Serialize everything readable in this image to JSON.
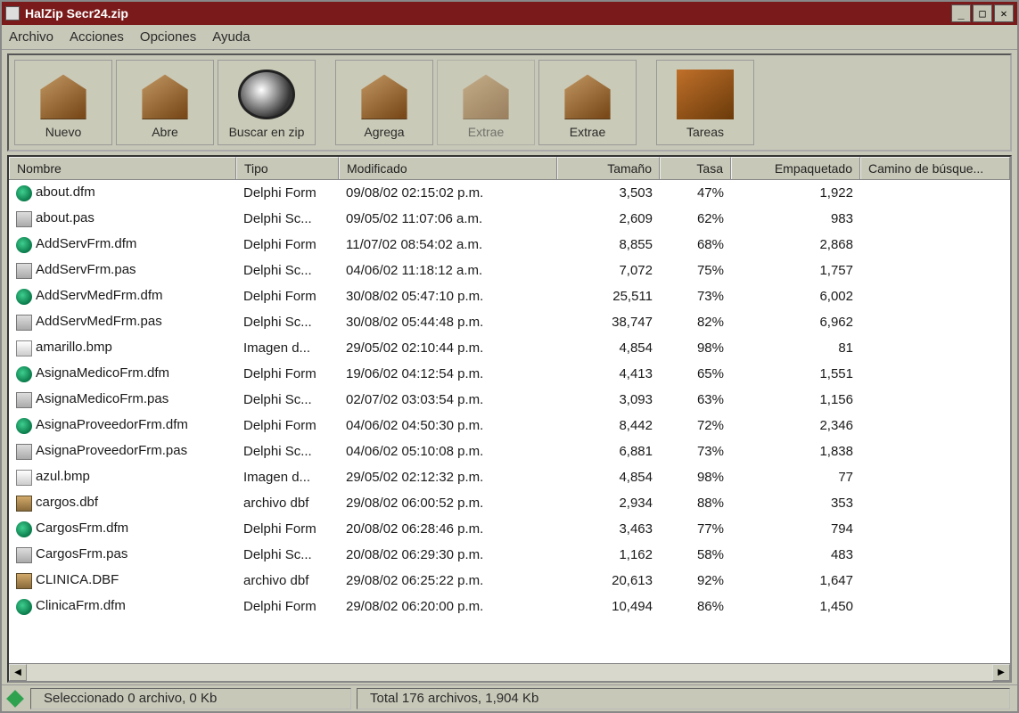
{
  "window": {
    "title": "HalZip Secr24.zip"
  },
  "menubar": [
    "Archivo",
    "Acciones",
    "Opciones",
    "Ayuda"
  ],
  "toolbar": [
    {
      "label": "Nuevo",
      "icon": "box-new",
      "disabled": false
    },
    {
      "label": "Abre",
      "icon": "box-open",
      "disabled": false
    },
    {
      "label": "Buscar en zip",
      "icon": "magnify",
      "disabled": false
    },
    {
      "label": "Agrega",
      "icon": "box-add",
      "disabled": false,
      "sep_before": true
    },
    {
      "label": "Extrae",
      "icon": "box-extract",
      "disabled": true
    },
    {
      "label": "Extrae",
      "icon": "box-extract2",
      "disabled": false
    },
    {
      "label": "Tareas",
      "icon": "tools",
      "disabled": false,
      "sep_before": true
    }
  ],
  "columns": [
    {
      "key": "nombre",
      "label": "Nombre"
    },
    {
      "key": "tipo",
      "label": "Tipo"
    },
    {
      "key": "mod",
      "label": "Modificado"
    },
    {
      "key": "tam",
      "label": "Tamaño"
    },
    {
      "key": "tasa",
      "label": "Tasa"
    },
    {
      "key": "emp",
      "label": "Empaquetado"
    },
    {
      "key": "cam",
      "label": "Camino de búsque..."
    }
  ],
  "files": [
    {
      "icon": "form",
      "nombre": "about.dfm",
      "tipo": "Delphi Form",
      "mod": "09/08/02 02:15:02 p.m.",
      "tam": "3,503",
      "tasa": "47%",
      "emp": "1,922"
    },
    {
      "icon": "source",
      "nombre": "about.pas",
      "tipo": "Delphi Sc...",
      "mod": "09/05/02 11:07:06 a.m.",
      "tam": "2,609",
      "tasa": "62%",
      "emp": "983"
    },
    {
      "icon": "form",
      "nombre": "AddServFrm.dfm",
      "tipo": "Delphi Form",
      "mod": "11/07/02 08:54:02 a.m.",
      "tam": "8,855",
      "tasa": "68%",
      "emp": "2,868"
    },
    {
      "icon": "source",
      "nombre": "AddServFrm.pas",
      "tipo": "Delphi Sc...",
      "mod": "04/06/02 11:18:12 a.m.",
      "tam": "7,072",
      "tasa": "75%",
      "emp": "1,757"
    },
    {
      "icon": "form",
      "nombre": "AddServMedFrm.dfm",
      "tipo": "Delphi Form",
      "mod": "30/08/02 05:47:10 p.m.",
      "tam": "25,511",
      "tasa": "73%",
      "emp": "6,002"
    },
    {
      "icon": "source",
      "nombre": "AddServMedFrm.pas",
      "tipo": "Delphi Sc...",
      "mod": "30/08/02 05:44:48 p.m.",
      "tam": "38,747",
      "tasa": "82%",
      "emp": "6,962"
    },
    {
      "icon": "image",
      "nombre": "amarillo.bmp",
      "tipo": "Imagen d...",
      "mod": "29/05/02 02:10:44 p.m.",
      "tam": "4,854",
      "tasa": "98%",
      "emp": "81"
    },
    {
      "icon": "form",
      "nombre": "AsignaMedicoFrm.dfm",
      "tipo": "Delphi Form",
      "mod": "19/06/02 04:12:54 p.m.",
      "tam": "4,413",
      "tasa": "65%",
      "emp": "1,551"
    },
    {
      "icon": "source",
      "nombre": "AsignaMedicoFrm.pas",
      "tipo": "Delphi Sc...",
      "mod": "02/07/02 03:03:54 p.m.",
      "tam": "3,093",
      "tasa": "63%",
      "emp": "1,156"
    },
    {
      "icon": "form",
      "nombre": "AsignaProveedorFrm.dfm",
      "tipo": "Delphi Form",
      "mod": "04/06/02 04:50:30 p.m.",
      "tam": "8,442",
      "tasa": "72%",
      "emp": "2,346"
    },
    {
      "icon": "source",
      "nombre": "AsignaProveedorFrm.pas",
      "tipo": "Delphi Sc...",
      "mod": "04/06/02 05:10:08 p.m.",
      "tam": "6,881",
      "tasa": "73%",
      "emp": "1,838"
    },
    {
      "icon": "image",
      "nombre": "azul.bmp",
      "tipo": "Imagen d...",
      "mod": "29/05/02 02:12:32 p.m.",
      "tam": "4,854",
      "tasa": "98%",
      "emp": "77"
    },
    {
      "icon": "dbf",
      "nombre": "cargos.dbf",
      "tipo": "archivo dbf",
      "mod": "29/08/02 06:00:52 p.m.",
      "tam": "2,934",
      "tasa": "88%",
      "emp": "353"
    },
    {
      "icon": "form",
      "nombre": "CargosFrm.dfm",
      "tipo": "Delphi Form",
      "mod": "20/08/02 06:28:46 p.m.",
      "tam": "3,463",
      "tasa": "77%",
      "emp": "794"
    },
    {
      "icon": "source",
      "nombre": "CargosFrm.pas",
      "tipo": "Delphi Sc...",
      "mod": "20/08/02 06:29:30 p.m.",
      "tam": "1,162",
      "tasa": "58%",
      "emp": "483"
    },
    {
      "icon": "dbf",
      "nombre": "CLINICA.DBF",
      "tipo": "archivo dbf",
      "mod": "29/08/02 06:25:22 p.m.",
      "tam": "20,613",
      "tasa": "92%",
      "emp": "1,647"
    },
    {
      "icon": "form",
      "nombre": "ClinicaFrm.dfm",
      "tipo": "Delphi Form",
      "mod": "29/08/02 06:20:00 p.m.",
      "tam": "10,494",
      "tasa": "86%",
      "emp": "1,450"
    }
  ],
  "status": {
    "selected": "Seleccionado 0 archivo, 0 Kb",
    "total": "Total 176 archivos, 1,904 Kb"
  }
}
